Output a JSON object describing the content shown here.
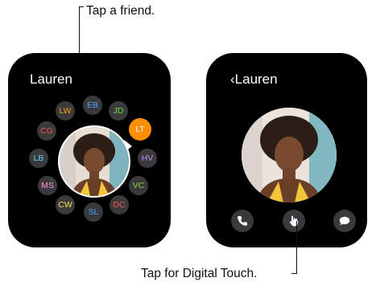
{
  "callouts": {
    "top": "Tap a friend.",
    "bottom": "Tap for Digital Touch."
  },
  "left_watch": {
    "name": "Lauren",
    "friends": [
      {
        "initials": "EB",
        "color": "#4aa3ff"
      },
      {
        "initials": "JD",
        "color": "#6fd43a"
      },
      {
        "initials": "LT",
        "color": "#ffffff",
        "selected": true
      },
      {
        "initials": "HV",
        "color": "#b98cff"
      },
      {
        "initials": "VC",
        "color": "#8ad53c"
      },
      {
        "initials": "DC",
        "color": "#ff4d4d"
      },
      {
        "initials": "SL",
        "color": "#43a8ff"
      },
      {
        "initials": "CW",
        "color": "#f2e14a"
      },
      {
        "initials": "MS",
        "color": "#ff8fd5"
      },
      {
        "initials": "LB",
        "color": "#4fd3ff"
      },
      {
        "initials": "CG",
        "color": "#ff4d4d"
      },
      {
        "initials": "LW",
        "color": "#f0a020"
      }
    ]
  },
  "right_watch": {
    "name": "‹Lauren",
    "buttons": [
      "phone-icon",
      "digital-touch-hand-icon",
      "message-bubble-icon"
    ]
  }
}
